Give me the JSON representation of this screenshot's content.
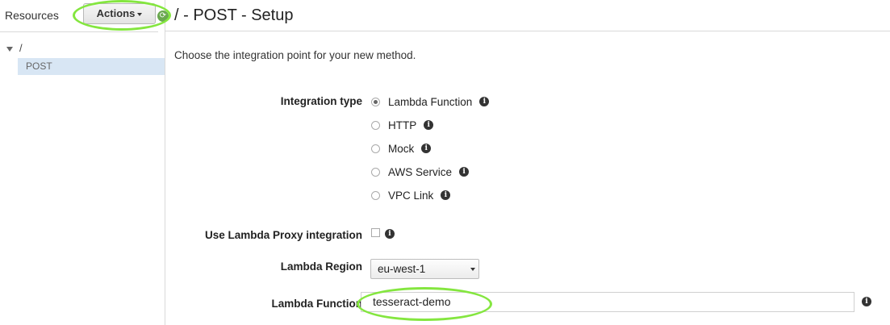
{
  "sidebar": {
    "resources_label": "Resources",
    "actions_label": "Actions",
    "tree": {
      "root": "/",
      "method": "POST"
    }
  },
  "header": {
    "title": "/ - POST - Setup"
  },
  "main": {
    "intro": "Choose the integration point for your new method.",
    "integration_type": {
      "label": "Integration type",
      "options": [
        "Lambda Function",
        "HTTP",
        "Mock",
        "AWS Service",
        "VPC Link"
      ],
      "selected": "Lambda Function"
    },
    "proxy": {
      "label": "Use Lambda Proxy integration",
      "checked": false
    },
    "region": {
      "label": "Lambda Region",
      "value": "eu-west-1"
    },
    "function": {
      "label": "Lambda Function",
      "value": "tesseract-demo"
    }
  },
  "icons": {
    "info": "info-icon",
    "caret": "caret-down-icon",
    "sync": "sync-icon"
  },
  "colors": {
    "highlight": "#84e63f",
    "selected_row": "#d8e6f4"
  }
}
